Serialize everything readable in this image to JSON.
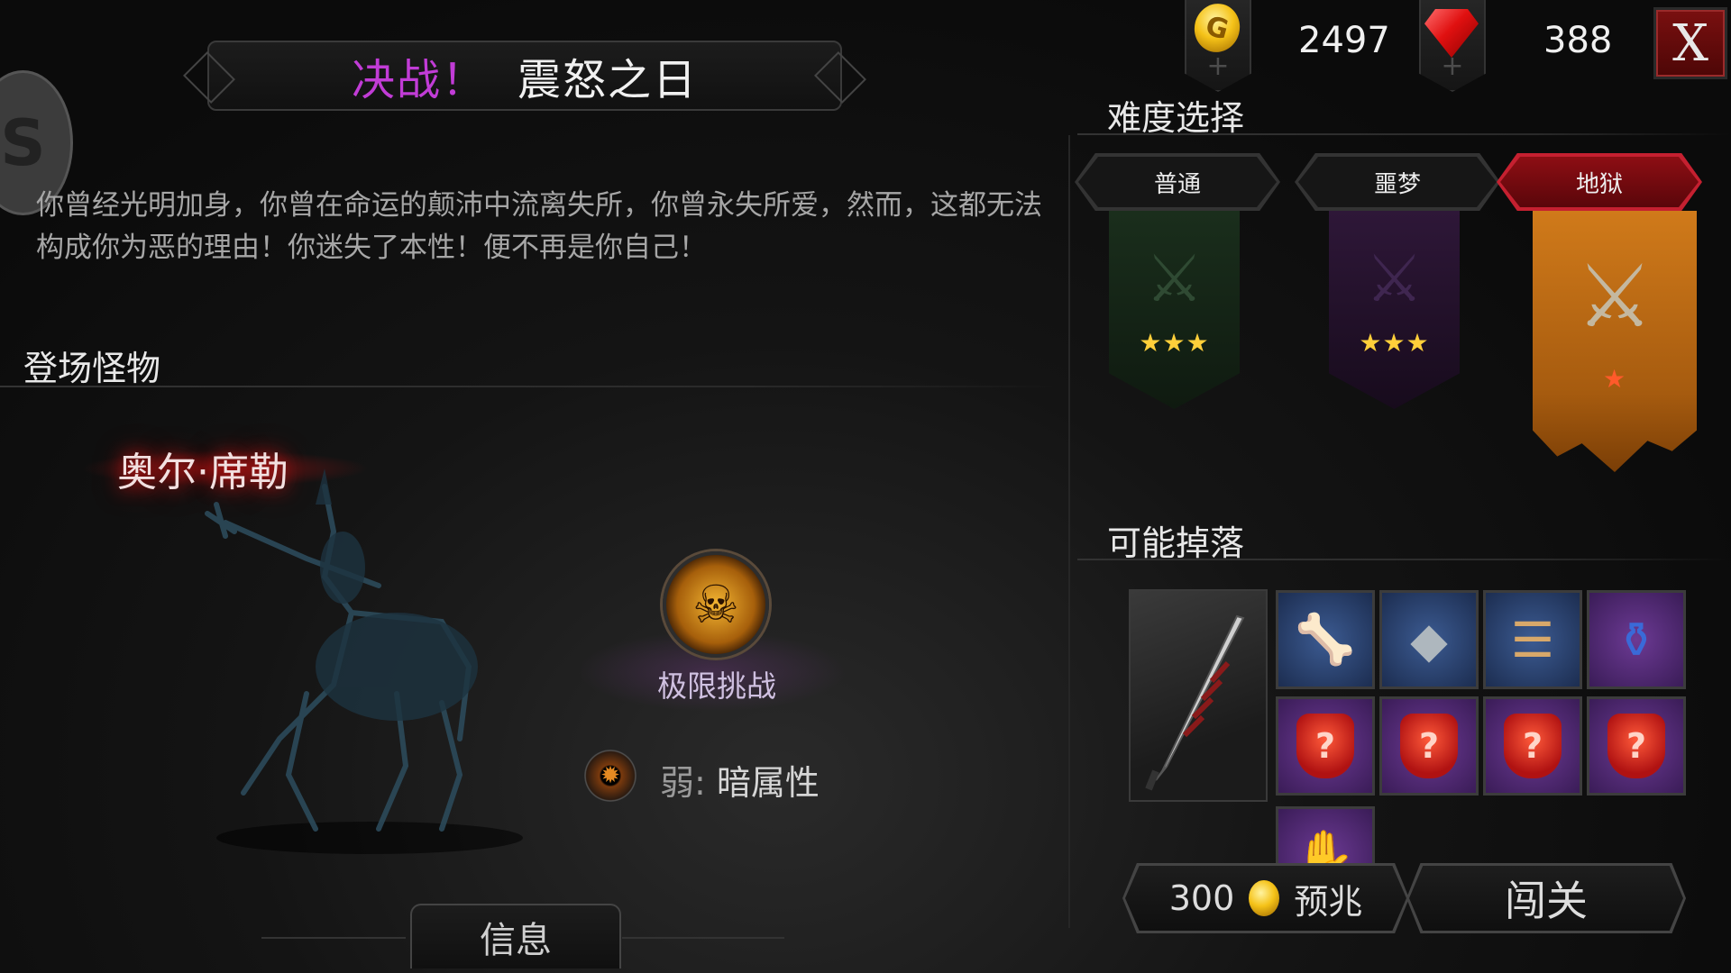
{
  "header": {
    "title_prefix": "决战！",
    "title_main": "震怒之日",
    "badge_glyph": "S"
  },
  "description": "你曾经光明加身，你曾在命运的颠沛中流离失所，你曾永失所爱，然而，这都无法构成你为恶的理由！你迷失了本性！便不再是你自己！",
  "monsters_section": {
    "heading": "登场怪物",
    "boss_name": "奥尔·席勒",
    "challenge_label": "极限挑战",
    "weakness_prefix": "弱:",
    "weakness_type": "暗属性"
  },
  "info_tab": "信息",
  "currency": {
    "gold": "2497",
    "gems": "388",
    "plus": "+"
  },
  "close_label": "X",
  "difficulty": {
    "heading": "难度选择",
    "tabs": [
      {
        "label": "普通",
        "stars": "★★★",
        "active": false,
        "color": "#1f3a22"
      },
      {
        "label": "噩梦",
        "stars": "★★★",
        "active": false,
        "color": "#3a1c45"
      },
      {
        "label": "地狱",
        "stars": "★",
        "active": true,
        "color": "#c8741a"
      }
    ]
  },
  "loot": {
    "heading": "可能掉落",
    "items": [
      {
        "name": "dark-greatsword",
        "rarity": "grey"
      },
      {
        "name": "bone-gauntlet",
        "rarity": "blue"
      },
      {
        "name": "stone-ore",
        "rarity": "blue"
      },
      {
        "name": "bone-bracer",
        "rarity": "blue"
      },
      {
        "name": "blue-vial",
        "rarity": "purple"
      },
      {
        "name": "mystery-red-armor",
        "rarity": "purple"
      },
      {
        "name": "mystery-red-armor",
        "rarity": "purple"
      },
      {
        "name": "mystery-red-armor",
        "rarity": "purple"
      },
      {
        "name": "mystery-red-armor",
        "rarity": "purple"
      },
      {
        "name": "flame-gauntlet",
        "rarity": "purple"
      }
    ]
  },
  "actions": {
    "preview_cost": "300",
    "preview_label": "预兆",
    "enter_label": "闯关"
  }
}
